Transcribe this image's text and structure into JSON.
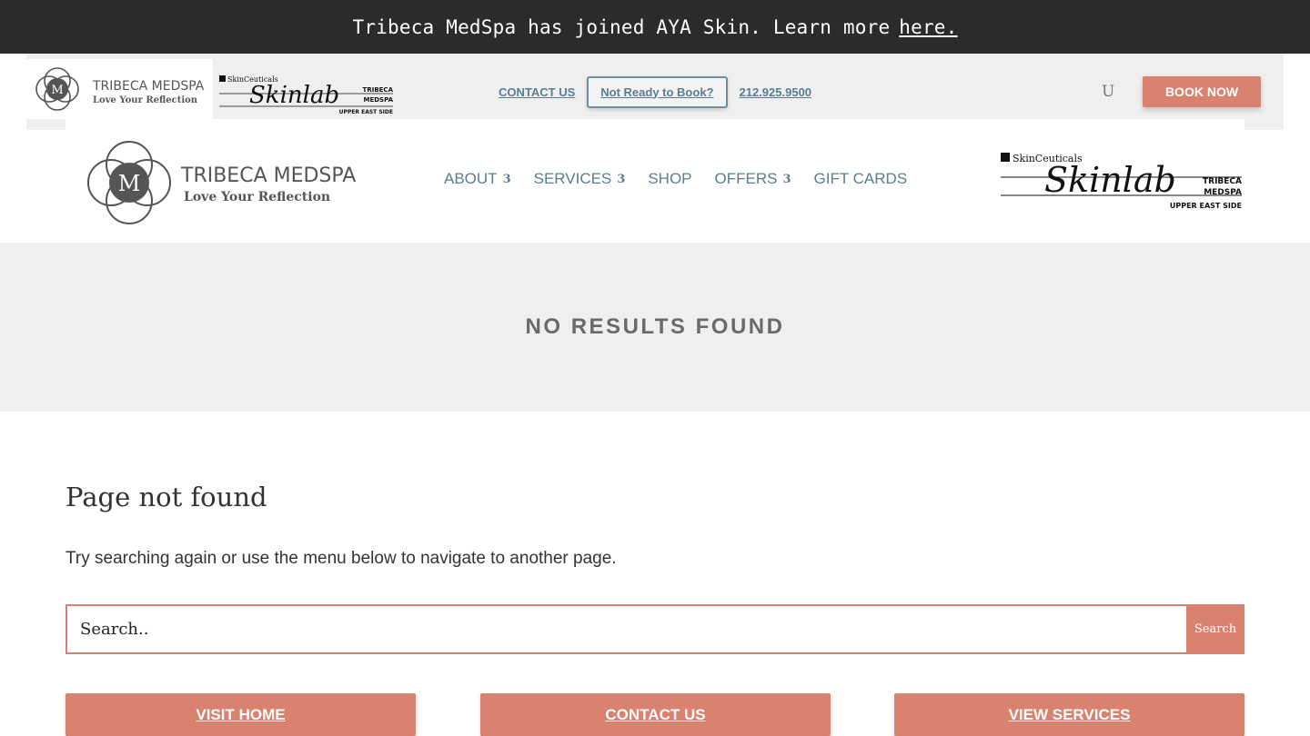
{
  "announcement": {
    "text": "Tribeca MedSpa has joined AYA Skin. Learn more",
    "link": "here."
  },
  "brand": {
    "name": "TRIBECA MEDSPA",
    "tagline": "Love Your Reflection"
  },
  "skinlab": {
    "brand": "SkinCeuticals",
    "script": "Skinlab",
    "line1": "TRIBECA",
    "line2": "MEDSPA",
    "line3": "UPPER EAST SIDE"
  },
  "topbar": {
    "contact": "CONTACT US",
    "not_ready": "Not Ready to Book?",
    "phone": "212.925.9500",
    "user_icon": "U",
    "book": "BOOK NOW"
  },
  "nav": [
    {
      "label": "ABOUT",
      "caret": "3"
    },
    {
      "label": "SERVICES",
      "caret": "3"
    },
    {
      "label": "SHOP"
    },
    {
      "label": "OFFERS",
      "caret": "3"
    },
    {
      "label": "GIFT CARDS"
    }
  ],
  "hero": {
    "title": "NO RESULTS FOUND"
  },
  "content": {
    "heading": "Page not found",
    "text": "Try searching again or use the menu below to navigate to another page.",
    "search_placeholder": "Search..",
    "search_button": "Search"
  },
  "buttons": [
    "VISIT HOME",
    "CONTACT US",
    "VIEW SERVICES"
  ],
  "colors": {
    "accent": "#d9826f",
    "nav": "#5a7d92",
    "dark": "#2b2b2b"
  }
}
